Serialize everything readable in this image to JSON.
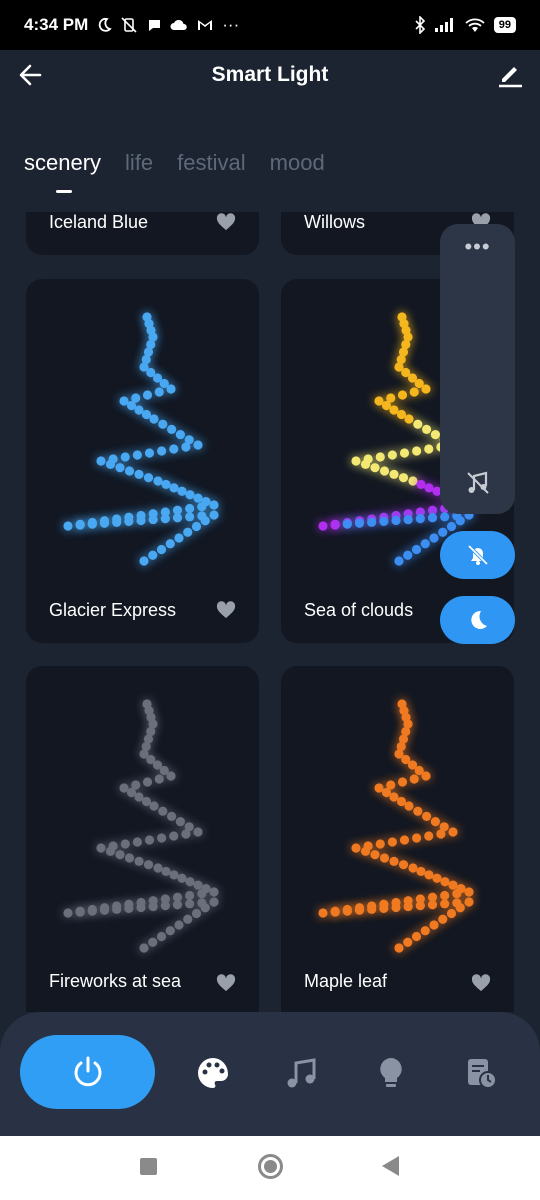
{
  "status_bar": {
    "time": "4:34 PM",
    "battery": "99",
    "left_icons": [
      "moon-icon",
      "vibrate-off-icon",
      "chat-icon",
      "cloud-icon",
      "gmail-icon",
      "more-icon"
    ],
    "right_icons": [
      "bluetooth-icon",
      "signal-icon",
      "wifi-icon",
      "battery-icon"
    ]
  },
  "app_bar": {
    "title": "Smart Light"
  },
  "tabs": [
    {
      "label": "scenery",
      "active": true
    },
    {
      "label": "life",
      "active": false
    },
    {
      "label": "festival",
      "active": false
    },
    {
      "label": "mood",
      "active": false
    }
  ],
  "scenes": [
    {
      "name": "Iceland Blue",
      "colors": []
    },
    {
      "name": "Willows",
      "colors": []
    },
    {
      "name": "Glacier Express",
      "colors": [
        "#4aa8f2"
      ]
    },
    {
      "name": "Sea of clouds",
      "colors": [
        "#f5b61f",
        "#f2e873",
        "#b12ff0",
        "#3c8ef2"
      ]
    },
    {
      "name": "Fireworks at sea",
      "colors": [
        "#6b6f7c"
      ]
    },
    {
      "name": "Maple leaf",
      "colors": [
        "#f07a22"
      ]
    }
  ],
  "float_panel": {
    "more": "•••"
  },
  "bottom_nav": {
    "items": [
      "power-icon",
      "palette-icon",
      "music-icon",
      "bulb-icon",
      "schedule-icon"
    ]
  },
  "accent": "#2f9ef4"
}
